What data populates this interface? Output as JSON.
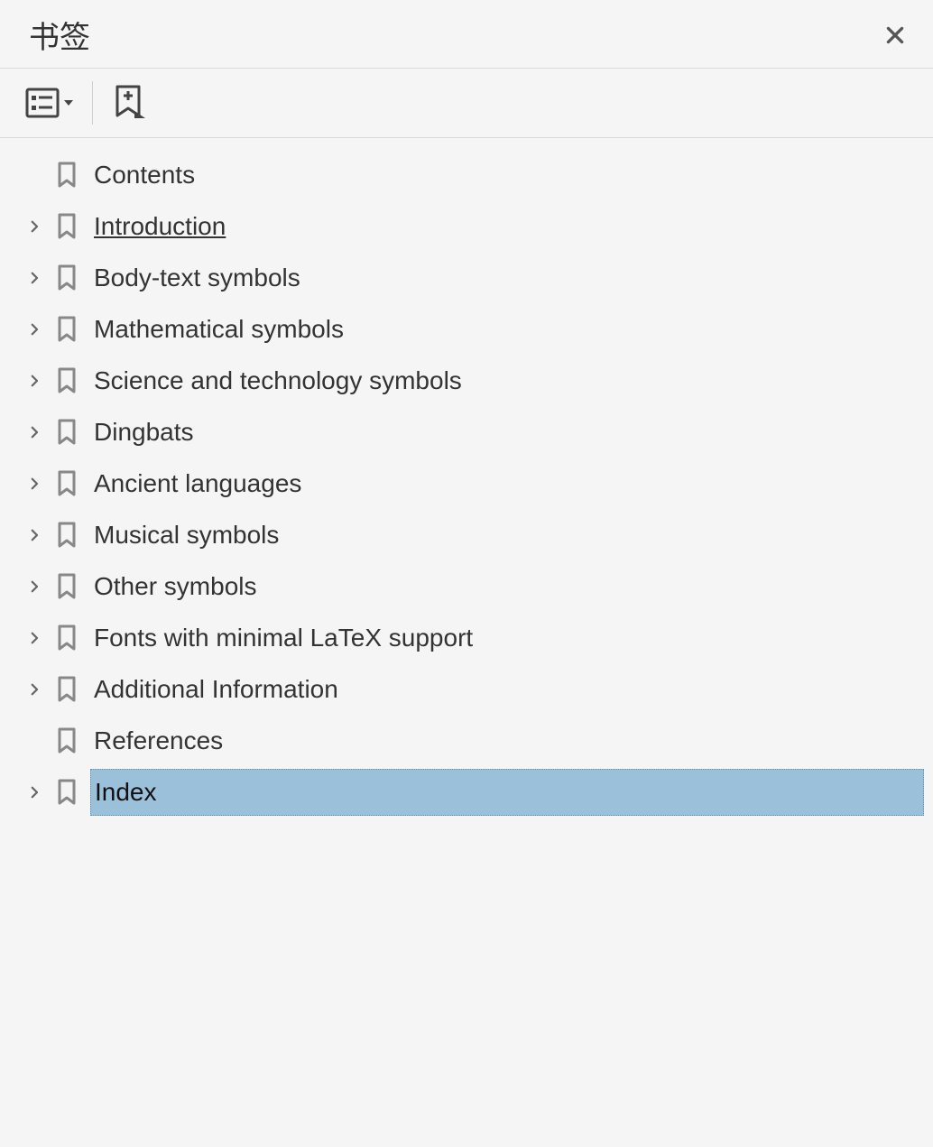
{
  "header": {
    "title": "书签"
  },
  "colors": {
    "selection_bg": "#9bc0d9",
    "border": "#d9d9d9",
    "icon": "#888888"
  },
  "bookmarks": [
    {
      "label": "Contents",
      "expandable": false,
      "hover": false,
      "selected": false
    },
    {
      "label": "Introduction",
      "expandable": true,
      "hover": true,
      "selected": false
    },
    {
      "label": "Body-text symbols",
      "expandable": true,
      "hover": false,
      "selected": false
    },
    {
      "label": "Mathematical symbols",
      "expandable": true,
      "hover": false,
      "selected": false
    },
    {
      "label": "Science and technology symbols",
      "expandable": true,
      "hover": false,
      "selected": false
    },
    {
      "label": "Dingbats",
      "expandable": true,
      "hover": false,
      "selected": false
    },
    {
      "label": "Ancient languages",
      "expandable": true,
      "hover": false,
      "selected": false
    },
    {
      "label": "Musical symbols",
      "expandable": true,
      "hover": false,
      "selected": false
    },
    {
      "label": "Other symbols",
      "expandable": true,
      "hover": false,
      "selected": false
    },
    {
      "label": "Fonts with minimal LaTeX support",
      "expandable": true,
      "hover": false,
      "selected": false
    },
    {
      "label": "Additional Information",
      "expandable": true,
      "hover": false,
      "selected": false
    },
    {
      "label": "References",
      "expandable": false,
      "hover": false,
      "selected": false
    },
    {
      "label": "Index",
      "expandable": true,
      "hover": false,
      "selected": true
    }
  ]
}
